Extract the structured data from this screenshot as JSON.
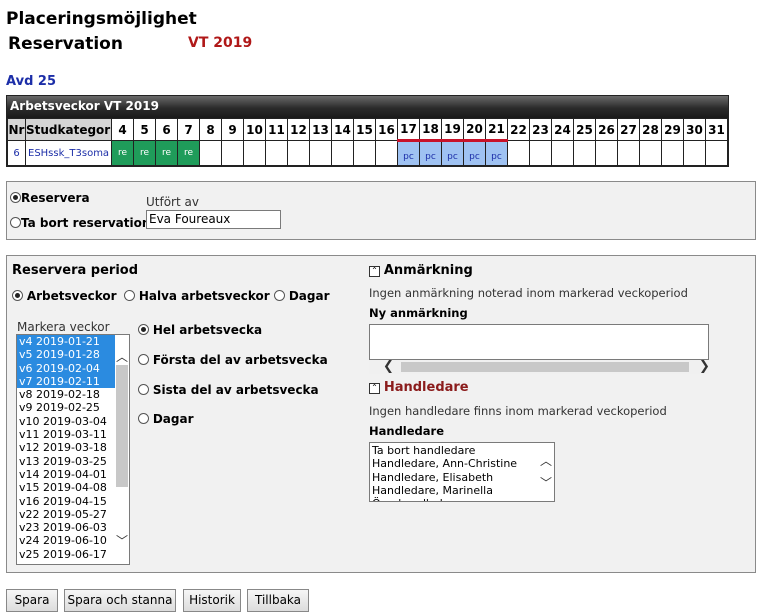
{
  "header": {
    "title": "Placeringsmöjlighet",
    "subtitle": "Reservation",
    "term": "VT 2019",
    "department": "Avd 25"
  },
  "weeks_grid": {
    "title": "Arbetsveckor VT 2019",
    "col_nr": "Nr",
    "col_category": "Studkategori",
    "weeks": [
      "4",
      "5",
      "6",
      "7",
      "8",
      "9",
      "10",
      "11",
      "12",
      "13",
      "14",
      "15",
      "16",
      "17",
      "18",
      "19",
      "20",
      "21",
      "22",
      "23",
      "24",
      "25",
      "26",
      "27",
      "28",
      "29",
      "30",
      "31"
    ],
    "row": {
      "nr": "6",
      "category": "ESHssk_T3soma",
      "cells": [
        "re",
        "re",
        "re",
        "re",
        "",
        "",
        "",
        "",
        "",
        "",
        "",
        "",
        "",
        "pc",
        "pc",
        "pc",
        "pc",
        "pc",
        "",
        "",
        "",
        "",
        "",
        "",
        "",
        "",
        "",
        ""
      ]
    }
  },
  "reservation": {
    "option_reserve": "Reservera",
    "option_remove": "Ta bort reservation",
    "performed_by_label": "Utfört av",
    "performed_by_value": "Eva Foureaux"
  },
  "period": {
    "title": "Reservera period",
    "modes": [
      "Arbetsveckor",
      "Halva arbetsveckor",
      "Dagar"
    ],
    "mark_weeks_label": "Markera veckor",
    "weeks_list": [
      {
        "label": "v4 2019-01-21",
        "selected": true
      },
      {
        "label": "v5 2019-01-28",
        "selected": true
      },
      {
        "label": "v6 2019-02-04",
        "selected": true
      },
      {
        "label": "v7 2019-02-11",
        "selected": true
      },
      {
        "label": "v8 2019-02-18",
        "selected": false
      },
      {
        "label": "v9 2019-02-25",
        "selected": false
      },
      {
        "label": "v10 2019-03-04",
        "selected": false
      },
      {
        "label": "v11 2019-03-11",
        "selected": false
      },
      {
        "label": "v12 2019-03-18",
        "selected": false
      },
      {
        "label": "v13 2019-03-25",
        "selected": false
      },
      {
        "label": "v14 2019-04-01",
        "selected": false
      },
      {
        "label": "v15 2019-04-08",
        "selected": false
      },
      {
        "label": "v16 2019-04-15",
        "selected": false
      },
      {
        "label": "v22 2019-05-27",
        "selected": false
      },
      {
        "label": "v23 2019-06-03",
        "selected": false
      },
      {
        "label": "v24 2019-06-10",
        "selected": false
      },
      {
        "label": "v25 2019-06-17",
        "selected": false
      }
    ],
    "week_part_options": [
      "Hel arbetsvecka",
      "Första del av arbetsvecka",
      "Sista del av arbetsvecka",
      "Dagar"
    ]
  },
  "remark": {
    "title": "Anmärkning",
    "info": "Ingen anmärkning noterad inom markerad veckoperiod",
    "new_label": "Ny anmärkning"
  },
  "supervisor": {
    "title": "Handledare",
    "info": "Ingen handledare finns inom markerad veckoperiod",
    "label": "Handledare",
    "options": [
      "Ta bort handledare",
      "Handledare, Ann-Christine",
      "Handledare, Elisabeth",
      "Handledare, Marinella",
      "Överhandledare"
    ]
  },
  "buttons": {
    "save": "Spara",
    "save_stay": "Spara och stanna",
    "history": "Historik",
    "back": "Tillbaka"
  },
  "colors": {
    "reserved": "#1f9c5a",
    "planned": "#9fc2f2",
    "selection": "#2b8be0",
    "term_red": "#b01818",
    "supervisor_title": "#8b1c1c"
  }
}
